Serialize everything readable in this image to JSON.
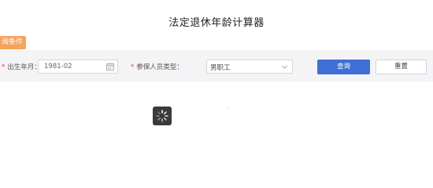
{
  "page": {
    "title": "法定退休年龄计算器"
  },
  "filters": {
    "tab_label": "询条件",
    "birth_label": "出生年月：",
    "birth_value": "1981-02",
    "type_label": "参保人员类型：",
    "type_value": "男职工",
    "required_mark": "*"
  },
  "actions": {
    "query_label": "查询",
    "reset_label": "重置"
  },
  "icons": {
    "date": "calendar-icon",
    "select": "chevron-down-icon",
    "loading": "loading-spinner-icon"
  },
  "colors": {
    "accent": "#3f6fd6",
    "tag": "#f7a35c",
    "required": "#e0453a"
  }
}
